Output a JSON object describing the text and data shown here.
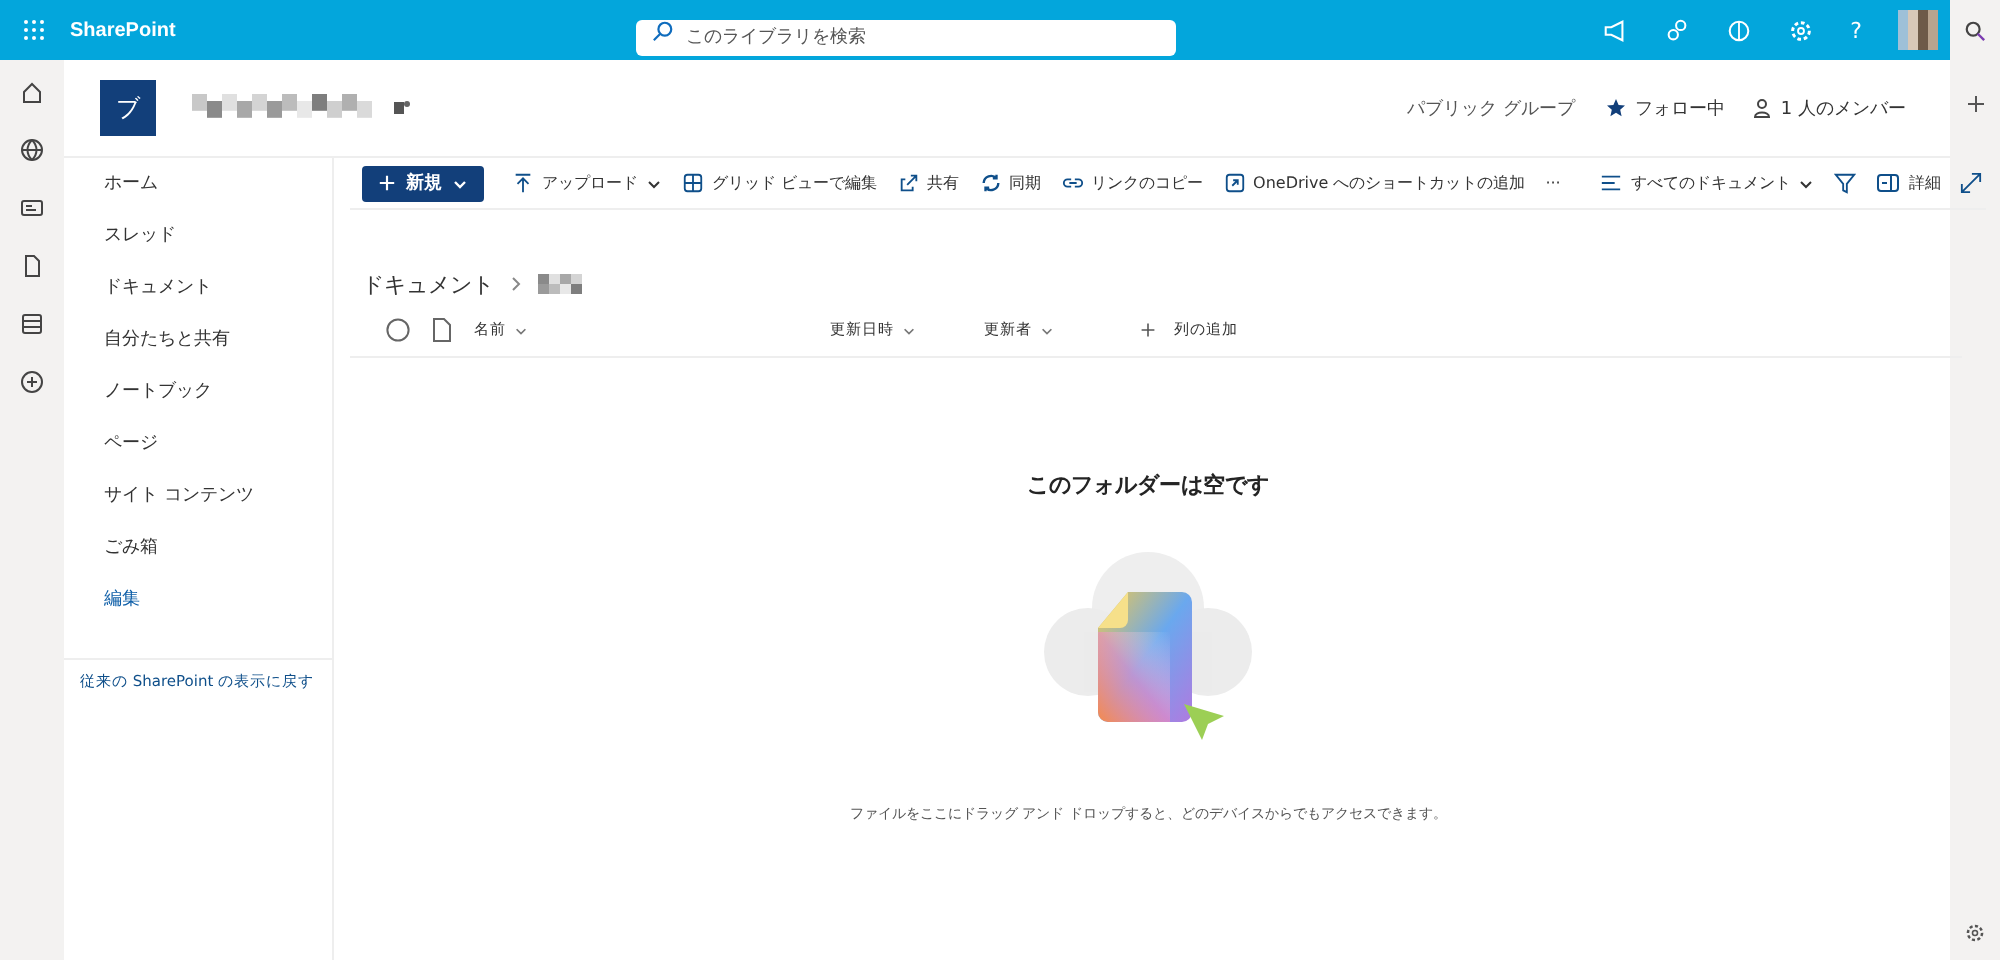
{
  "top_bar": {
    "app_name": "SharePoint",
    "search": {
      "placeholder": "このライブラリを検索"
    },
    "help": "?"
  },
  "site": {
    "logo_letter": "ブ",
    "privacy": "パブリック グループ",
    "follow": "フォロー中",
    "members": "1 人のメンバー"
  },
  "nav": {
    "items": [
      {
        "label": "ホーム",
        "kind": "item"
      },
      {
        "label": "スレッド",
        "kind": "item"
      },
      {
        "label": "ドキュメント",
        "kind": "item"
      },
      {
        "label": "自分たちと共有",
        "kind": "item"
      },
      {
        "label": "ノートブック",
        "kind": "item"
      },
      {
        "label": "ページ",
        "kind": "item"
      },
      {
        "label": "サイト コンテンツ",
        "kind": "item"
      },
      {
        "label": "ごみ箱",
        "kind": "item"
      },
      {
        "label": "編集",
        "kind": "link"
      }
    ],
    "classic_link": "従来の SharePoint の表示に戻す"
  },
  "command_bar": {
    "new": "新規",
    "actions": [
      {
        "label": "アップロード",
        "kind": "upload",
        "dropdown": true
      },
      {
        "label": "グリッド ビューで編集",
        "kind": "grid",
        "dropdown": false
      },
      {
        "label": "共有",
        "kind": "share",
        "dropdown": false
      },
      {
        "label": "同期",
        "kind": "sync",
        "dropdown": false
      },
      {
        "label": "リンクのコピー",
        "kind": "link",
        "dropdown": false
      },
      {
        "label": "OneDrive へのショートカットの追加",
        "kind": "shortcut",
        "dropdown": false
      }
    ],
    "more": "···",
    "view": "すべてのドキュメント",
    "details": "詳細"
  },
  "breadcrumb": {
    "root": "ドキュメント"
  },
  "table": {
    "select_all": {
      "checked": false
    },
    "columns": [
      {
        "label": "名前",
        "kind": "sort"
      },
      {
        "label": "更新日時",
        "kind": "sort"
      },
      {
        "label": "更新者",
        "kind": "sort"
      },
      {
        "label": "列の追加",
        "kind": "add"
      }
    ]
  },
  "empty_state": {
    "title": "このフォルダーは空です",
    "hint": "ファイルをここにドラッグ アンド ドロップすると、どのデバイスからでもアクセスできます。"
  }
}
